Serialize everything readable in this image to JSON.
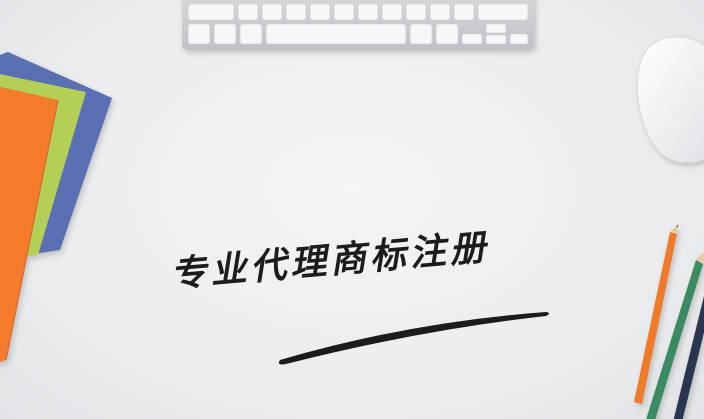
{
  "headline": "专业代理商标注册",
  "colors": {
    "background": "#ebedef",
    "notebook_orange": "#f47c2c",
    "notebook_green": "#b4cf55",
    "notebook_blue": "#5a6fb3",
    "pencil_orange": "#ee7a2a",
    "pencil_green": "#3a8a64",
    "pencil_navy": "#2c3550",
    "keyboard": "#c9ccd0",
    "mouse": "#f7f7f8"
  },
  "objects": [
    "keyboard",
    "mouse",
    "notebooks",
    "pencils",
    "brush-stroke"
  ]
}
